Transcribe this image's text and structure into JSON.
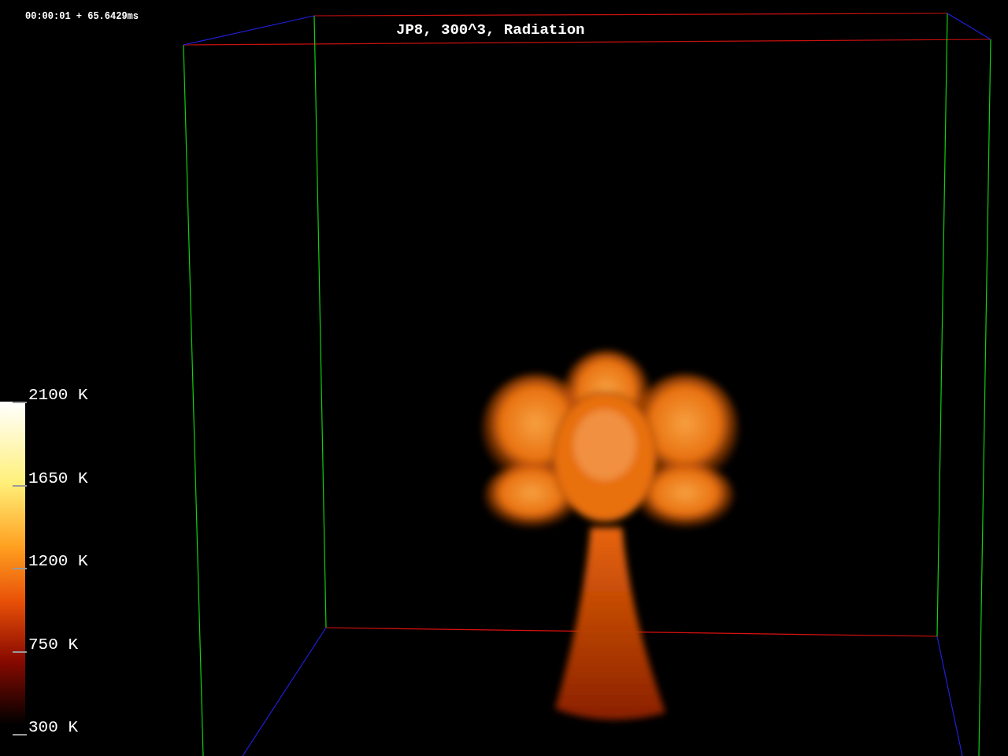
{
  "timestamp": "00:00:01 + 65.6429ms",
  "title": "JP8, 300^3, Radiation",
  "colorbar": {
    "labels": [
      "2100 K",
      "1650 K",
      "1200 K",
      "750 K",
      "300 K"
    ]
  }
}
